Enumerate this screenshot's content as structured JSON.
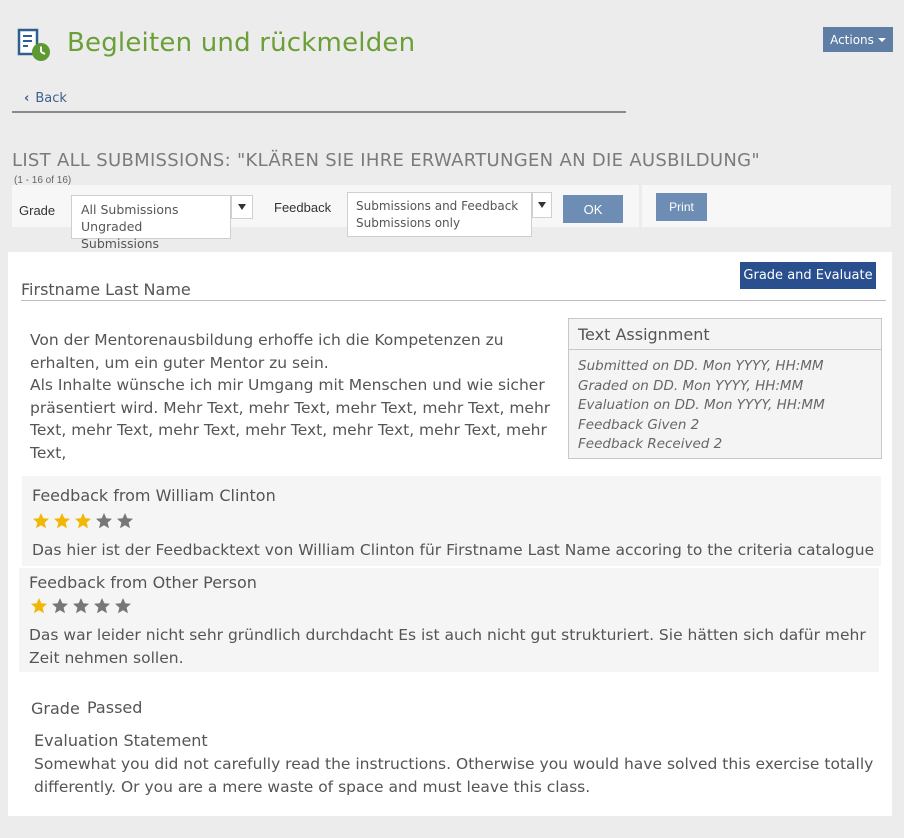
{
  "header": {
    "title": "Begleiten und rückmelden",
    "actions_label": "Actions",
    "back_label": "Back",
    "accent_color": "#6b9f38"
  },
  "list": {
    "title": "LIST ALL SUBMISSIONS: \"KLÄREN SIE IHRE ERWARTUNGEN AN DIE AUSBILDUNG\"",
    "count": "(1 - 16 of 16)"
  },
  "filters": {
    "grade_label": "Grade",
    "grade_options": [
      "All Submissions",
      "Ungraded Submissions"
    ],
    "feedback_label": "Feedback",
    "feedback_options": [
      "Submissions and Feedback",
      "Submissions only"
    ],
    "ok_label": "OK",
    "print_label": "Print"
  },
  "submission": {
    "grade_evaluate_label": "Grade and Evaluate",
    "student_name": "Firstname Last Name",
    "text_lines": [
      "Von der Mentorenausbildung erhoffe ich die Kompetenzen zu",
      "erhalten, um ein guter Mentor zu sein.",
      "Als Inhalte wünsche ich mir Umgang mit Menschen und wie sicher",
      "präsentiert wird. Mehr Text, mehr Text, mehr Text, mehr Text, mehr",
      "Text, mehr Text, mehr Text, mehr Text, mehr Text, mehr Text, mehr",
      "Text,"
    ],
    "assignment": {
      "title": "Text Assignment",
      "submitted": "Submitted on DD. Mon YYYY, HH:MM",
      "graded": "Graded on DD. Mon YYYY, HH:MM",
      "evaluation": "Evaluation on DD. Mon YYYY, HH:MM",
      "feedback_given": "Feedback Given 2",
      "feedback_received": "Feedback Received 2"
    },
    "feedbacks": [
      {
        "title": "Feedback from William Clinton",
        "rating": 3,
        "max_rating": 5,
        "text": "Das hier ist der Feedbacktext von William Clinton für Firstname Last Name accoring to the criteria catalogue"
      },
      {
        "title": "Feedback from Other Person",
        "rating": 1,
        "max_rating": 5,
        "text": "Das war leider nicht sehr gründlich durchdacht Es ist auch nicht  gut strukturiert. Sie hätten sich dafür mehr Zeit nehmen sollen."
      }
    ],
    "grade_label": "Grade",
    "grade_value": "Passed",
    "evaluation_label": "Evaluation Statement",
    "evaluation_text": "Somewhat you did not carefully read the instructions. Otherwise you would have solved this exercise totally differently. Or you are a mere waste of space and must leave this class."
  },
  "colors": {
    "star_filled": "#f2b705",
    "star_empty": "#777777",
    "button_primary": "#2a4f8f",
    "button_secondary": "#6e8db5"
  }
}
